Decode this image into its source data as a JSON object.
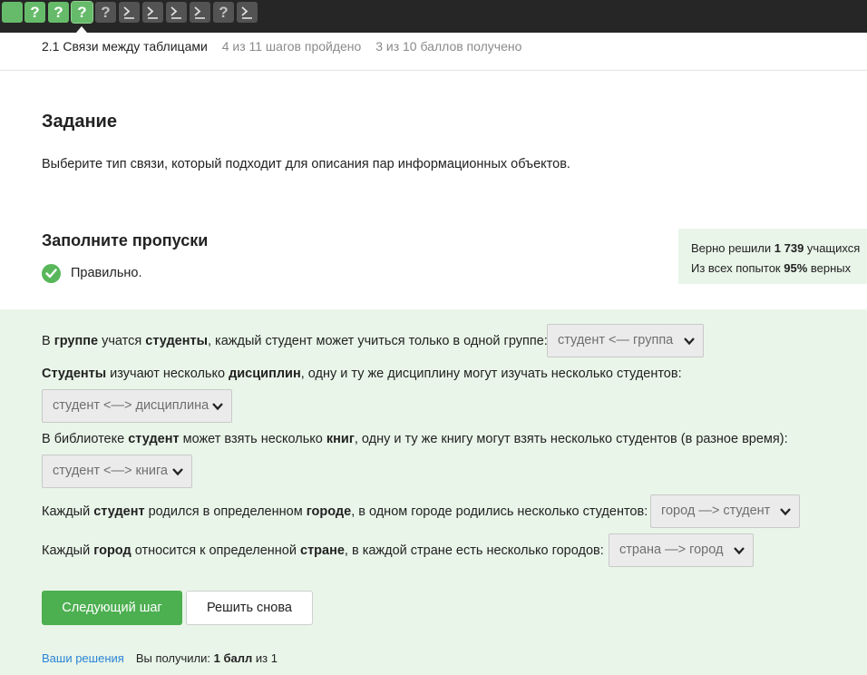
{
  "steps": [
    {
      "kind": "green",
      "glyph": ""
    },
    {
      "kind": "green",
      "glyph": "?"
    },
    {
      "kind": "green",
      "glyph": "?"
    },
    {
      "kind": "green-active",
      "glyph": "?"
    },
    {
      "kind": "question",
      "glyph": "?"
    },
    {
      "kind": "terminal",
      "glyph": ""
    },
    {
      "kind": "terminal",
      "glyph": ""
    },
    {
      "kind": "terminal",
      "glyph": ""
    },
    {
      "kind": "terminal",
      "glyph": ""
    },
    {
      "kind": "question",
      "glyph": "?"
    },
    {
      "kind": "terminal",
      "glyph": ""
    }
  ],
  "breadcrumb": {
    "lesson": "2.1 Связи между таблицами",
    "steps_done": "4 из 11 шагов пройдено",
    "points": "3 из 10 баллов  получено"
  },
  "task": {
    "heading": "Задание",
    "text": "Выберите тип связи, который подходит для описания пар информационных объектов."
  },
  "fill": {
    "heading": "Заполните пропуски",
    "verdict": "Правильно."
  },
  "stats": {
    "solved_prefix": "Верно решили ",
    "solved_count": "1 739",
    "solved_suffix": " учащихся",
    "attempts_prefix": "Из всех попыток ",
    "attempts_percent": "95%",
    "attempts_suffix": " верных"
  },
  "questions": {
    "q1": {
      "p1": "В ",
      "b1": "группе",
      "p2": " учатся ",
      "b2": "студенты",
      "p3": ", каждый студент может учиться только в одной группе:",
      "answer": "студент <— группа"
    },
    "q2": {
      "b1": "Студенты",
      "p1": " изучают несколько ",
      "b2": "дисциплин",
      "p2": ", одну и ту же дисциплину могут изучать несколько студентов:",
      "answer": "студент <—> дисциплина"
    },
    "q3": {
      "p1": "В библиотеке ",
      "b1": "студент",
      "p2": " может взять несколько ",
      "b2": "книг",
      "p3": ", одну и ту же книгу могут взять несколько студентов (в разное время):",
      "answer": "студент <—> книга"
    },
    "q4": {
      "p1": "Каждый ",
      "b1": "студент",
      "p2": " родился в определенном ",
      "b2": "городе",
      "p3": ", в одном городе родились несколько студентов:",
      "answer": "город —> студент"
    },
    "q5": {
      "p1": "Каждый ",
      "b1": "город",
      "p2": " относится к определенной ",
      "b2": "стране",
      "p3": ", в каждой стране есть несколько городов:",
      "answer": "страна —> город"
    }
  },
  "buttons": {
    "next": "Следующий шаг",
    "retry": "Решить снова"
  },
  "footer": {
    "link": "Ваши решения",
    "prefix": "Вы получили: ",
    "score": "1 балл",
    "suffix": " из 1"
  },
  "colors": {
    "accent_green": "#4caf50",
    "topbar": "#262626",
    "answer_bg": "#e9f5e9",
    "link": "#2b83d6"
  }
}
